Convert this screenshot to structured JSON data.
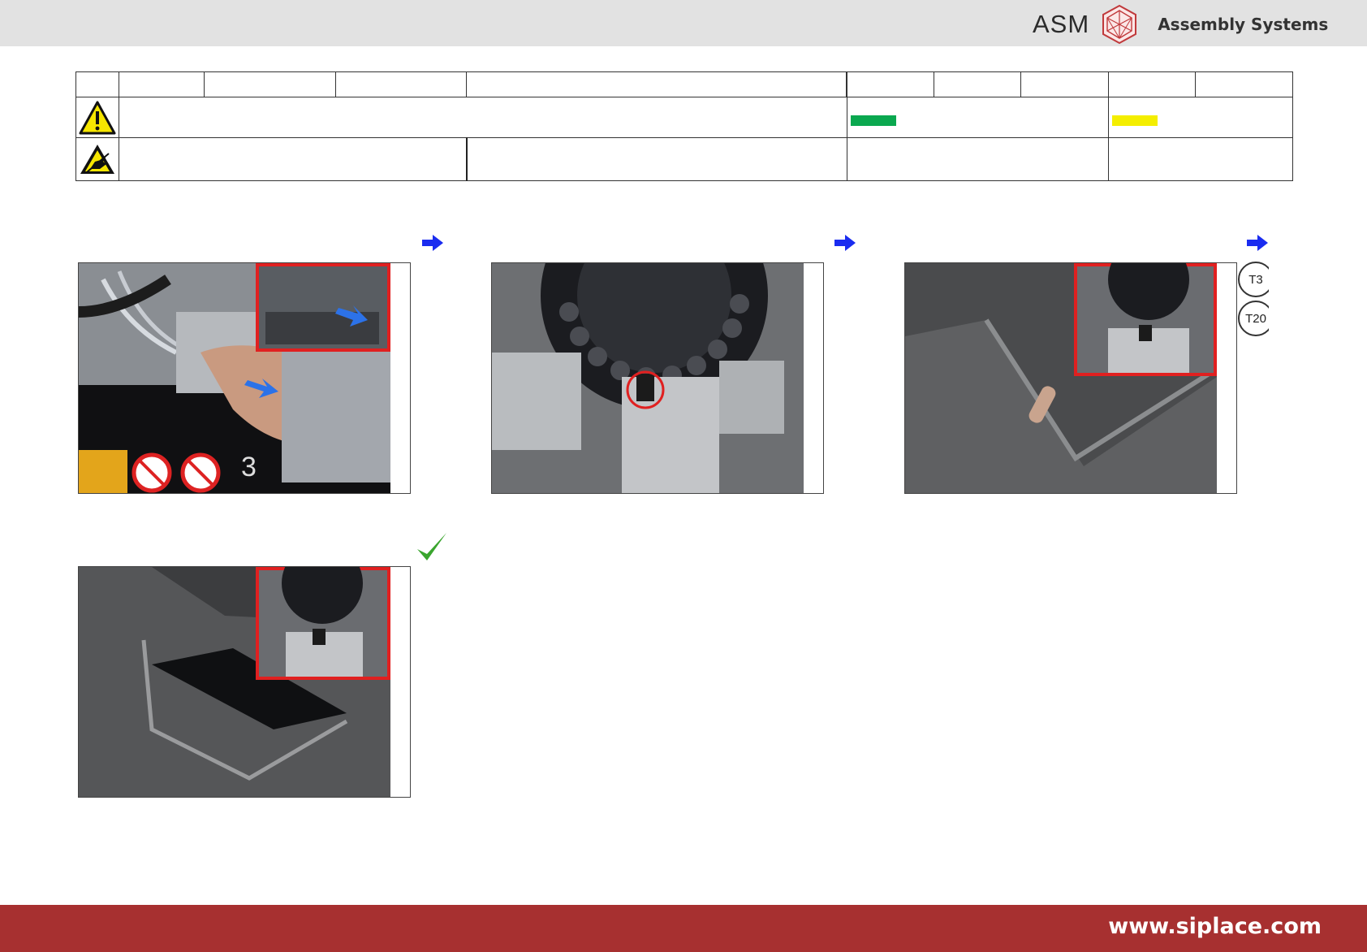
{
  "header": {
    "brand_name": "ASM",
    "brand_subtitle": "Assembly Systems",
    "logo_icon": "asm-hexagon-logo-icon"
  },
  "info_table": {
    "warning_icon": "warning-triangle-icon",
    "esd_icon": "esd-hand-icon",
    "status_colors": {
      "green": "#0aa84f",
      "yellow": "#f4ee00"
    }
  },
  "steps": [
    {
      "id": "step-1",
      "image": "photo-hand-on-machine",
      "next_icon": "arrow-right-icon"
    },
    {
      "id": "step-2",
      "image": "photo-gripper-head",
      "next_icon": "arrow-right-icon"
    },
    {
      "id": "step-3",
      "image": "photo-resistor-on-plate",
      "next_icon": "arrow-right-icon",
      "tools": [
        "T3",
        "T20"
      ]
    },
    {
      "id": "step-4",
      "image": "photo-plate-closeup",
      "status_icon": "check-mark-icon"
    }
  ],
  "footer": {
    "url": "www.siplace.com"
  },
  "colors": {
    "footer": "#a73030",
    "header": "#e2e2e2",
    "arrow": "#1a2cf0",
    "check": "#3aa52e",
    "highlight": "#e02020"
  }
}
